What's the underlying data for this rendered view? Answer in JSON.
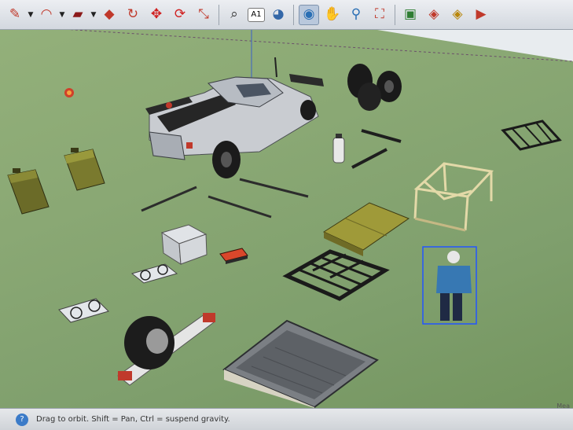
{
  "toolbar": {
    "tools": [
      {
        "icon": "pencil-icon",
        "glyph": "✎",
        "color": "#c0392b"
      },
      {
        "icon": "arc-icon",
        "glyph": "◠",
        "color": "#c0392b"
      },
      {
        "icon": "rectangle-icon",
        "glyph": "▰",
        "color": "#8b1a1a"
      },
      {
        "icon": "push-pull-icon",
        "glyph": "◆",
        "color": "#c0392b"
      },
      {
        "icon": "follow-me-icon",
        "glyph": "↻",
        "color": "#c0392b"
      },
      {
        "icon": "move-icon",
        "glyph": "✥",
        "color": "#d02020"
      },
      {
        "icon": "rotate-icon",
        "glyph": "⟳",
        "color": "#d02020"
      },
      {
        "icon": "scale-icon",
        "glyph": "⤡",
        "color": "#c0392b"
      },
      {
        "icon": "tape-measure-icon",
        "glyph": "⌕",
        "color": "#333333"
      },
      {
        "icon": "text-icon",
        "glyph": "A1",
        "color": "#222222"
      },
      {
        "icon": "paint-bucket-icon",
        "glyph": "◕",
        "color": "#3367a8"
      },
      {
        "icon": "orbit-icon",
        "glyph": "◉",
        "color": "#2a6fb5"
      },
      {
        "icon": "pan-icon",
        "glyph": "✋",
        "color": "#444444"
      },
      {
        "icon": "zoom-icon",
        "glyph": "⚲",
        "color": "#2a6fb5"
      },
      {
        "icon": "zoom-extents-icon",
        "glyph": "⛶",
        "color": "#c0392b"
      },
      {
        "icon": "warehouse-icon",
        "glyph": "▣",
        "color": "#2e7d32"
      },
      {
        "icon": "get-models-icon",
        "glyph": "◈",
        "color": "#c0392b"
      },
      {
        "icon": "share-model-icon",
        "glyph": "◈",
        "color": "#b8860b"
      },
      {
        "icon": "extension-icon",
        "glyph": "▶",
        "color": "#c0392b"
      }
    ],
    "text_tool_label": "A1"
  },
  "status": {
    "message": "Drag to orbit. Shift = Pan, Ctrl = suspend gravity.",
    "measurements_label": "Mea"
  },
  "colors": {
    "ground": "#8aa874",
    "selection": "#2255ff",
    "status_icon": "#3b7bc8"
  }
}
